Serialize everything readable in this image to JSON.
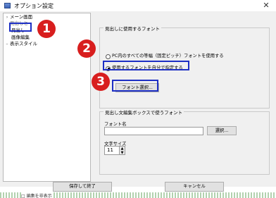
{
  "window": {
    "title": "オプション設定",
    "close_glyph": "✕"
  },
  "tree": {
    "items": [
      {
        "glyph": "›",
        "label": "メーン画面"
      },
      {
        "glyph": "",
        "label": "見出しと"
      },
      {
        "glyph": "",
        "label": "見出し"
      },
      {
        "glyph": "",
        "label": "画像編集"
      },
      {
        "glyph": "–",
        "label": "表示スタイル"
      }
    ]
  },
  "badges": {
    "one": "1",
    "two": "2",
    "three": "3"
  },
  "heading_font_group": {
    "title": "見出しに使用するフォント",
    "options": [
      {
        "label": "PC内のすべての等幅（固定ピッチ）フォントを使用する",
        "selected": false
      },
      {
        "label": "使用するフォントを自分で指定する",
        "selected": true
      }
    ],
    "select_button": "フォント選択..."
  },
  "editbox_font_group": {
    "title": "見出し文編集ボックスで使うフォント",
    "font_name_label": "フォント名",
    "font_name_value": "",
    "browse_button": "選択...",
    "size_label": "文字サイズ",
    "size_value": "11"
  },
  "footer": {
    "ok_button": "保存して終了",
    "cancel_button": "キャンセル"
  },
  "background": {
    "text": "□ 編集を非表示"
  },
  "colors": {
    "highlight_box": "#1d2fc4",
    "badge": "#d81e1e"
  }
}
